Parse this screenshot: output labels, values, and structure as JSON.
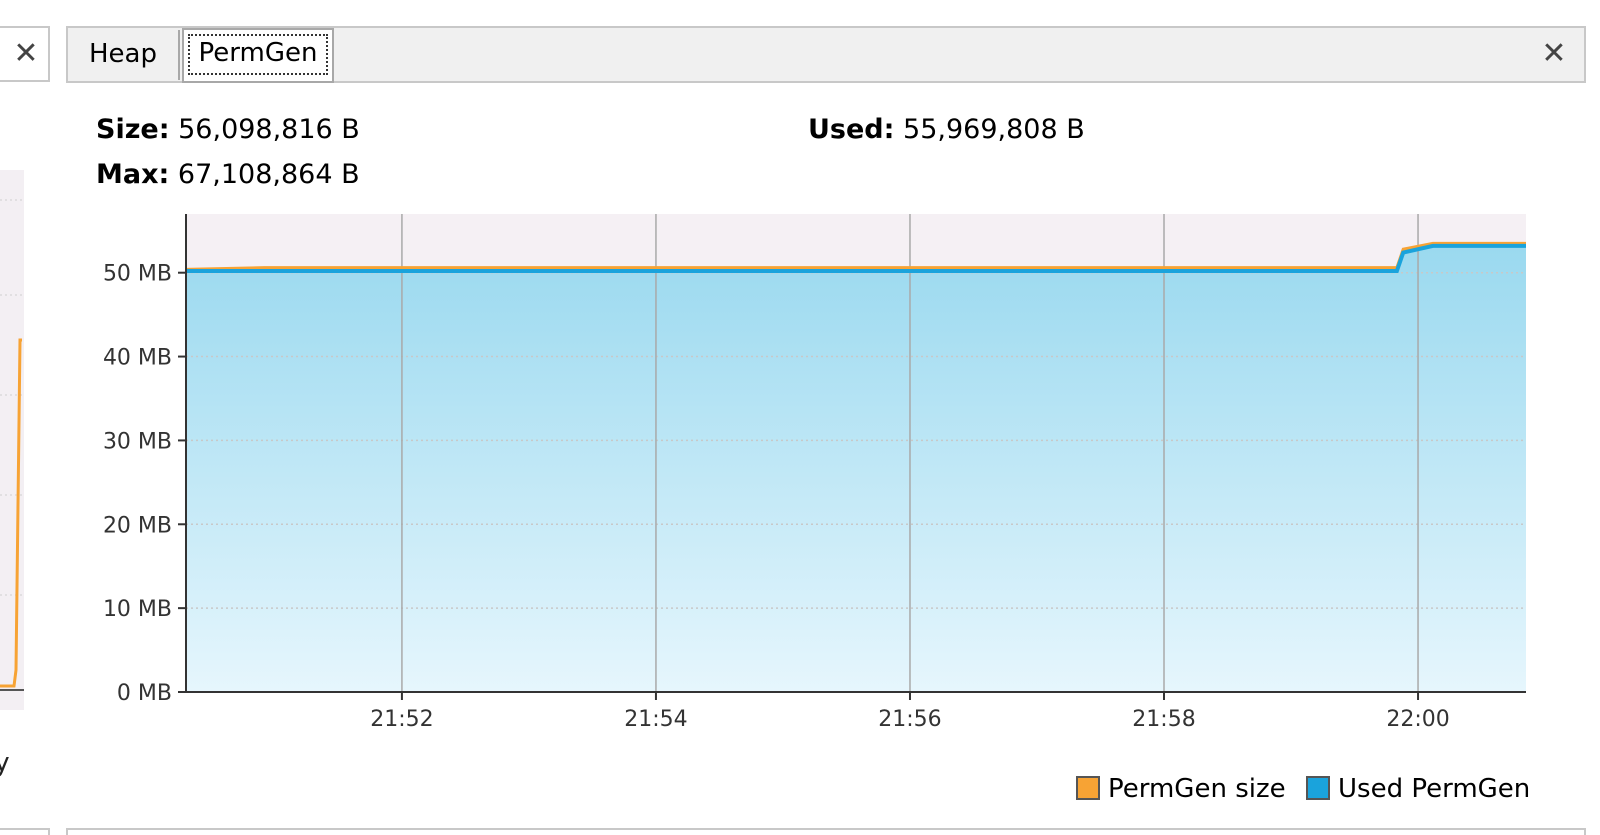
{
  "left_panel": {
    "close_label": "✕",
    "legend_fragment": "ty"
  },
  "tabs": [
    {
      "label": "Heap",
      "selected": false
    },
    {
      "label": "PermGen",
      "selected": true
    }
  ],
  "close_label": "✕",
  "stats": {
    "size_label": "Size:",
    "size_value": "56,098,816 B",
    "used_label": "Used:",
    "used_value": "55,969,808 B",
    "max_label": "Max:",
    "max_value": "67,108,864 B"
  },
  "colors": {
    "permgen_size": "#f7a334",
    "used_permgen": "#1aa3dc",
    "plot_background": "#f5f0f4"
  },
  "chart_data": {
    "type": "area",
    "y_ticks": [
      "0 MB",
      "10 MB",
      "20 MB",
      "30 MB",
      "40 MB",
      "50 MB"
    ],
    "y_tick_values": [
      0,
      10,
      20,
      30,
      40,
      50
    ],
    "x_ticks": [
      "21:52",
      "21:54",
      "21:56",
      "21:58",
      "22:00"
    ],
    "x_tick_values": [
      "21:52",
      "21:54",
      "21:56",
      "21:58",
      "22:00"
    ],
    "xlim": [
      "21:50:18",
      "21:60:51"
    ],
    "ylim": [
      0,
      57
    ],
    "grid": true,
    "legend_position": "bottom-right",
    "series": [
      {
        "name": "PermGen size",
        "color": "#f7a334",
        "x": [
          "21:50:18",
          "21:50:55",
          "21:59:50",
          "21:59:53",
          "21:60:07",
          "21:60:51"
        ],
        "y": [
          50.4,
          50.6,
          50.6,
          52.8,
          53.5,
          53.5
        ]
      },
      {
        "name": "Used PermGen",
        "color": "#1aa3dc",
        "x": [
          "21:50:18",
          "21:59:50",
          "21:59:53",
          "21:60:07",
          "21:60:51"
        ],
        "y": [
          50.2,
          50.2,
          52.4,
          53.2,
          53.2
        ]
      }
    ]
  },
  "left_chart_data": {
    "type": "line",
    "color": "#f7a334"
  }
}
